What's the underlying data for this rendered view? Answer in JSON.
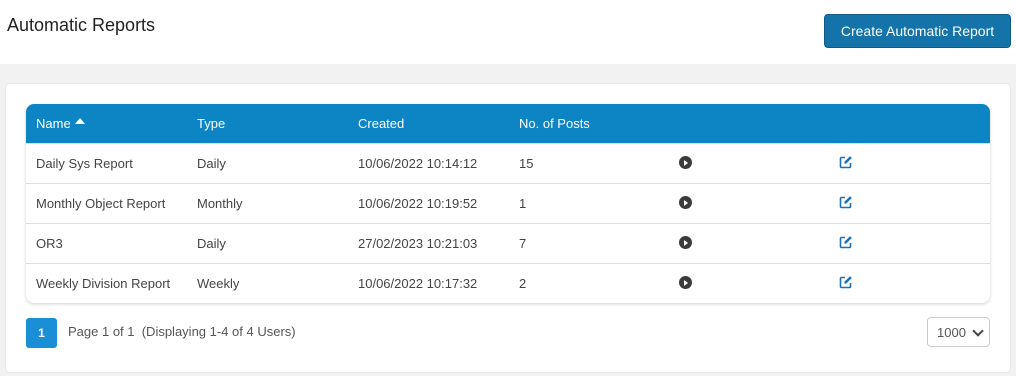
{
  "header": {
    "title": "Automatic Reports",
    "create_label": "Create Automatic Report"
  },
  "table": {
    "columns": [
      "Name",
      "Type",
      "Created",
      "No. of Posts"
    ],
    "sort_column": "Name",
    "sort_direction": "ascending",
    "rows": [
      {
        "name": "Daily Sys Report",
        "type": "Daily",
        "created": "10/06/2022 10:14:12",
        "posts": "15"
      },
      {
        "name": "Monthly Object Report",
        "type": "Monthly",
        "created": "10/06/2022 10:19:52",
        "posts": "1"
      },
      {
        "name": "OR3",
        "type": "Daily",
        "created": "27/02/2023 10:21:03",
        "posts": "7"
      },
      {
        "name": "Weekly Division Report",
        "type": "Weekly",
        "created": "10/06/2022 10:17:32",
        "posts": "2"
      }
    ],
    "row_icons": [
      "play-icon",
      "edit-icon"
    ]
  },
  "pager": {
    "current_page": "1",
    "info": "Page 1 of 1  (Displaying 1-4 of 4 Users)",
    "page_size": "1000"
  },
  "colors": {
    "accent": "#0d84c3",
    "button": "#1473a8",
    "pager_active": "#1a8fd6"
  }
}
